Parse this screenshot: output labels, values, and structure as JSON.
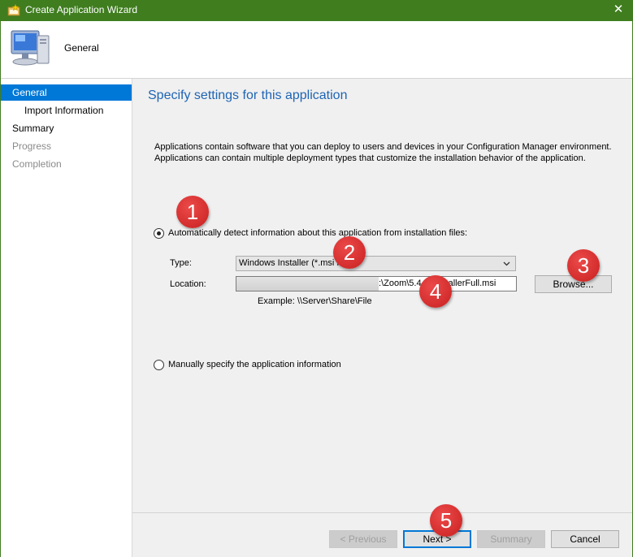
{
  "window": {
    "title": "Create Application Wizard"
  },
  "header": {
    "page_name": "General"
  },
  "nav": {
    "items": [
      {
        "label": "General"
      },
      {
        "label": "Import Information"
      },
      {
        "label": "Summary"
      },
      {
        "label": "Progress"
      },
      {
        "label": "Completion"
      }
    ]
  },
  "main": {
    "heading": "Specify settings for this application",
    "description_line1": "Applications contain software that you can deploy to users and devices in your Configuration Manager environment.",
    "description_line2": "Applications can contain multiple deployment types that customize the installation behavior of the application.",
    "auto_detect": {
      "label": "Automatically detect information about this application from installation files:",
      "selected": true,
      "type_label": "Type:",
      "type_value": "Windows Installer (*.msi file)",
      "location_label": "Location:",
      "location_value": ":\\Zoom\\5.4.         mInstallerFull.msi",
      "browse_label": "Browse...",
      "example": "Example: \\\\Server\\Share\\File"
    },
    "manual": {
      "label": "Manually specify the application information",
      "selected": false
    }
  },
  "footer": {
    "previous_label": "< Previous",
    "next_label": "Next >",
    "summary_label": "Summary",
    "cancel_label": "Cancel"
  },
  "annotations": [
    "1",
    "2",
    "3",
    "4",
    "5"
  ],
  "colors": {
    "titlebar": "#3f7d1f",
    "accent": "#0078d7",
    "heading": "#1e64b4",
    "badge": "#d72c2c"
  },
  "icons": [
    "wizard-icon",
    "close-icon",
    "computer-icon",
    "chevron-down-icon"
  ]
}
